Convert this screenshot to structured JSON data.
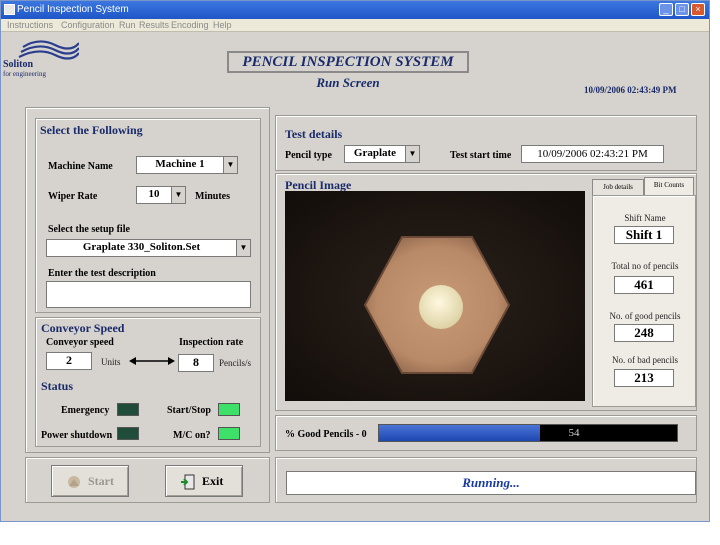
{
  "window": {
    "title": "Pencil Inspection System"
  },
  "menu": [
    "Instructions",
    "Configuration",
    "Run",
    "Results",
    "Encoding",
    "Help"
  ],
  "logo": {
    "name": "Soliton",
    "tagline": "for engineering"
  },
  "header": {
    "title": "PENCIL INSPECTION SYSTEM",
    "subtitle": "Run Screen",
    "datetime": "10/09/2006 02:43:49 PM"
  },
  "select_panel": {
    "title": "Select the Following",
    "machine_label": "Machine Name",
    "machine_value": "Machine 1",
    "wiper_label": "Wiper Rate",
    "wiper_value": "10",
    "wiper_unit": "Minutes",
    "setup_label": "Select the setup file",
    "setup_value": "Graplate 330_Soliton.Set",
    "desc_label": "Enter the test description",
    "desc_value": ""
  },
  "conveyor": {
    "title": "Conveyor Speed",
    "speed_label": "Conveyor speed",
    "speed_value": "2",
    "speed_unit": "Units",
    "rate_label": "Inspection rate",
    "rate_value": "8",
    "rate_unit": "Pencils/s"
  },
  "status": {
    "title": "Status",
    "emergency": "Emergency",
    "start_stop": "Start/Stop",
    "power_shutdown": "Power shutdown",
    "mc_on": "M/C on?",
    "colors": {
      "on": "#3ee06a",
      "off": "#1f4d3a"
    }
  },
  "buttons": {
    "start": "Start",
    "exit": "Exit"
  },
  "test_details": {
    "title": "Test details",
    "pencil_type_label": "Pencil type",
    "pencil_type_value": "Graplate",
    "start_time_label": "Test start time",
    "start_time_value": "10/09/2006 02:43:21 PM"
  },
  "pencil_image": {
    "title": "Pencil Image"
  },
  "tabs": [
    "Job details",
    "Bit Counts"
  ],
  "stats": {
    "shift_label": "Shift Name",
    "shift_value": "Shift 1",
    "total_label": "Total no of pencils",
    "total_value": "461",
    "good_label": "No. of good pencils",
    "good_value": "248",
    "bad_label": "No. of bad pencils",
    "bad_value": "213"
  },
  "progress": {
    "label": "% Good Pencils - 0",
    "percent": 54,
    "value_text": "54"
  },
  "status_bar": {
    "text": "Running..."
  }
}
